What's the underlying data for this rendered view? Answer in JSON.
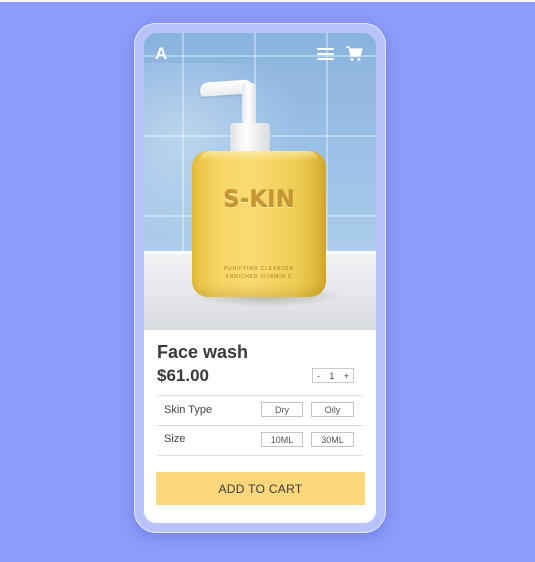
{
  "header": {
    "brand_letter": "A",
    "menu_icon": "hamburger-menu-icon",
    "cart_icon": "shopping-cart-icon"
  },
  "hero": {
    "bottle_brand": "S-KIN",
    "bottle_caption_line1": "PURIFYING CLEANSER",
    "bottle_caption_line2": "ENRICHED VITAMIN C"
  },
  "product": {
    "name": "Face wash",
    "price": "$61.00",
    "quantity": {
      "minus": "-",
      "value": "1",
      "plus": "+"
    }
  },
  "options": [
    {
      "label": "Skin Type",
      "choices": [
        "Dry",
        "Oily"
      ]
    },
    {
      "label": "Size",
      "choices": [
        "10ML",
        "30ML"
      ]
    }
  ],
  "cta": {
    "add_to_cart": "ADD TO CART"
  },
  "colors": {
    "background": "#8d9bfb",
    "phone_frame": "#b9c3fb",
    "cta": "#fcd77c",
    "bottle": "#f6d667"
  }
}
